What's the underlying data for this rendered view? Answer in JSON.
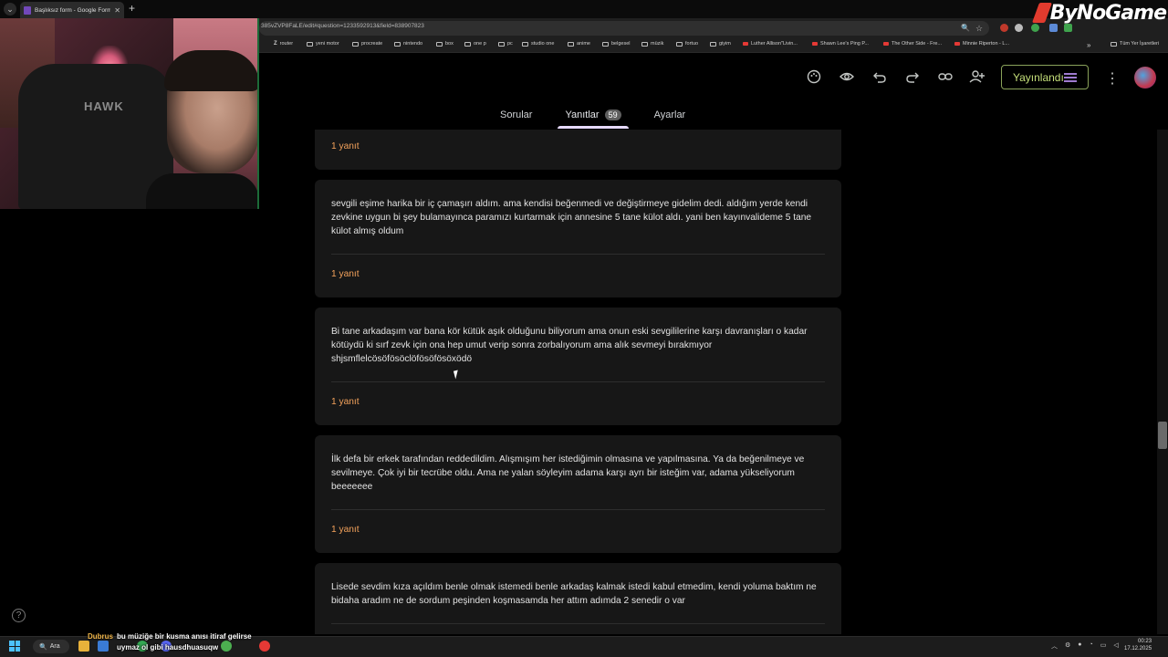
{
  "browser": {
    "tab_title": "Başlıksız form - Google Formlar",
    "url": "385vZVP8FaLE/edit#question=1233592913&field=838907823",
    "bookmarks": [
      "router",
      "yeni motor",
      "procreate",
      "nintendo",
      "box",
      "one p",
      "pc",
      "studio one",
      "anime",
      "belgesel",
      "müzik",
      "fortuo",
      "giyim",
      "Luther Allison\"Livin...",
      "Shawn Lee's Ping P...",
      "The Other Side - Fre...",
      "Minnie Riperton - L..."
    ],
    "all_bookmarks": "Tüm Yer İşaretleri"
  },
  "overlay": {
    "logo": "ByNoGame",
    "chair_logo": "HAWK"
  },
  "forms": {
    "publish_label": "Yayınlandı",
    "tabs": [
      {
        "label": "Sorular"
      },
      {
        "label": "Yanıtlar",
        "badge": "59"
      },
      {
        "label": "Ayarlar"
      }
    ]
  },
  "responses": [
    {
      "text": "",
      "count": "1 yanıt"
    },
    {
      "text": "sevgili eşime harika bir iç çamaşırı aldım. ama kendisi beğenmedi ve değiştirmeye gidelim dedi. aldığım yerde kendi zevkine uygun bi şey bulamayınca paramızı kurtarmak için annesine 5 tane külot aldı. yani ben kayınvalideme 5 tane külot almış oldum",
      "count": "1 yanıt"
    },
    {
      "text": "Bi tane arkadaşım var bana kör kütük aşık olduğunu biliyorum ama onun eski sevgililerine karşı davranışları o kadar kötüydü ki sırf zevk için ona hep umut verip sonra zorbalıyorum ama alık sevmeyi bırakmıyor shjsmflelcösöfösöclöfösöfösöxödö",
      "count": "1 yanıt"
    },
    {
      "text": "İlk defa bir erkek tarafından reddedildim. Alışmışım her istediğimin olmasına ve yapılmasına. Ya da beğenilmeye ve sevilmeye. Çok iyi bir tecrübe oldu. Ama ne yalan söyleyim adama karşı ayrı bir isteğim var, adama yükseliyorum beeeeeee",
      "count": "1 yanıt"
    },
    {
      "text": "Lisede sevdim kıza açıldım benle olmak istemedi benle arkadaş kalmak istedi kabul etmedim, kendi yoluma baktım ne bidaha aradım ne de sordum peşinden koşmasamda her attım adımda 2 senedir o var",
      "count": ""
    }
  ],
  "taskbar": {
    "search_label": "Ara",
    "chat_user": "Dubrus",
    "chat_line1": "bu müziğe bir kusma anısı itiraf gelirse",
    "chat_line2": "uymaz ol gibi hausdhuasuqw",
    "time": "00:23",
    "date": "17.12.2025"
  },
  "colors": {
    "accent_orange": "#f5a35c",
    "publish_green": "#c5df7a",
    "card_bg": "#171717"
  }
}
